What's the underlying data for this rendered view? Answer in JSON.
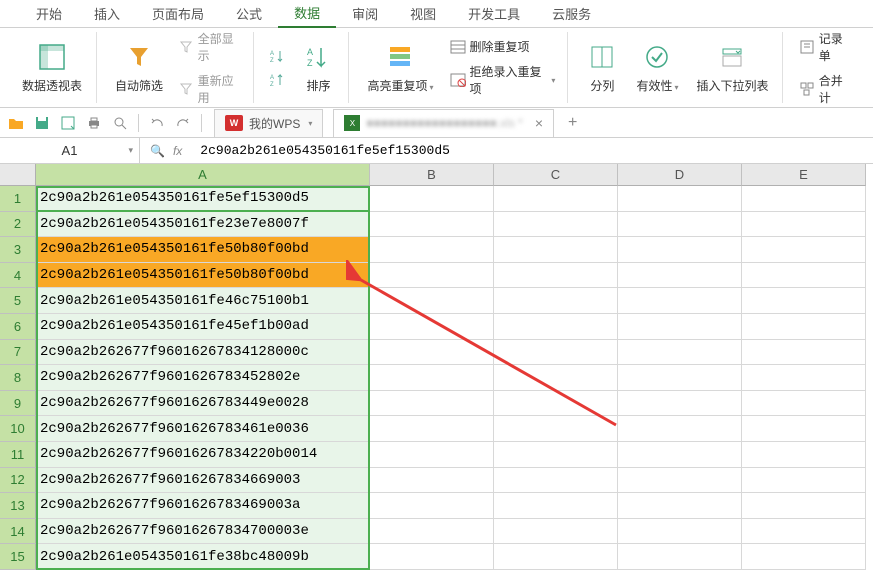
{
  "tabs": {
    "start": "开始",
    "insert": "插入",
    "layout": "页面布局",
    "formula": "公式",
    "data": "数据",
    "review": "审阅",
    "view": "视图",
    "devtools": "开发工具",
    "cloud": "云服务"
  },
  "ribbon": {
    "pivot": "数据透视表",
    "autofilter": "自动筛选",
    "showall": "全部显示",
    "reapply": "重新应用",
    "sort": "排序",
    "highlight_dup": "高亮重复项",
    "remove_dup": "删除重复项",
    "reject_dup": "拒绝录入重复项",
    "text_to_cols": "分列",
    "validation": "有效性",
    "dropdown": "插入下拉列表",
    "consolidate": "合并计",
    "record": "记录单"
  },
  "document_tabs": {
    "wps_home": "我的WPS",
    "file_name": "■■■■■■■■■■■■■■■■■■.xls *"
  },
  "formula_bar": {
    "cell_ref": "A1",
    "fx": "fx",
    "content": "2c90a2b261e054350161fe5ef15300d5"
  },
  "columns": [
    "A",
    "B",
    "C",
    "D",
    "E"
  ],
  "rows": [
    {
      "n": 1,
      "a": "2c90a2b261e054350161fe5ef15300d5",
      "dup": false
    },
    {
      "n": 2,
      "a": "2c90a2b261e054350161fe23e7e8007f",
      "dup": false
    },
    {
      "n": 3,
      "a": "2c90a2b261e054350161fe50b80f00bd",
      "dup": true
    },
    {
      "n": 4,
      "a": "2c90a2b261e054350161fe50b80f00bd",
      "dup": true
    },
    {
      "n": 5,
      "a": "2c90a2b261e054350161fe46c75100b1",
      "dup": false
    },
    {
      "n": 6,
      "a": "2c90a2b261e054350161fe45ef1b00ad",
      "dup": false
    },
    {
      "n": 7,
      "a": "2c90a2b262677f96016267834128000c",
      "dup": false
    },
    {
      "n": 8,
      "a": "2c90a2b262677f9601626783452802e",
      "dup": false
    },
    {
      "n": 9,
      "a": "2c90a2b262677f9601626783449e0028",
      "dup": false
    },
    {
      "n": 10,
      "a": "2c90a2b262677f9601626783461e0036",
      "dup": false
    },
    {
      "n": 11,
      "a": "2c90a2b262677f96016267834220b0014",
      "dup": false
    },
    {
      "n": 12,
      "a": "2c90a2b262677f96016267834669003",
      "dup": false
    },
    {
      "n": 13,
      "a": "2c90a2b262677f9601626783469003a",
      "dup": false
    },
    {
      "n": 14,
      "a": "2c90a2b262677f96016267834700003e",
      "dup": false
    },
    {
      "n": 15,
      "a": "2c90a2b261e054350161fe38bc48009b",
      "dup": false
    }
  ]
}
